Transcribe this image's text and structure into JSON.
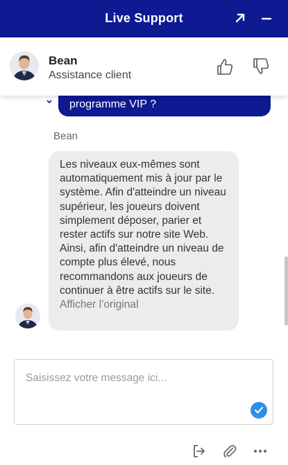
{
  "window": {
    "title": "Live Support",
    "header_bg": "#0e1a92",
    "expand_icon": "arrow-up-right-icon",
    "minimize_icon": "minus-icon"
  },
  "agent": {
    "name": "Bean",
    "role": "Assistance client",
    "thumbs_up_icon": "thumbs-up-icon",
    "thumbs_down_icon": "thumbs-down-icon"
  },
  "conversation": {
    "previous_user_message_tail": "programme VIP ?",
    "sender": "Bean",
    "agent_message": "Les niveaux eux-mêmes sont automatiquement mis à jour par le système. Afin d'atteindre un niveau supérieur, les joueurs doivent simplement déposer, parier et rester actifs sur notre site Web.",
    "agent_message_2": "Ainsi, afin d'atteindre un niveau de compte plus élevé, nous recommandons aux joueurs de continuer à être actifs sur le site.",
    "show_original": "Afficher l’original"
  },
  "composer": {
    "placeholder": "Saisissez votre message ici...",
    "value": "",
    "send_color": "#2f8fe6"
  },
  "toolbar": {
    "icons": [
      "exit-chat-icon",
      "paperclip-icon",
      "more-dots-icon"
    ]
  }
}
